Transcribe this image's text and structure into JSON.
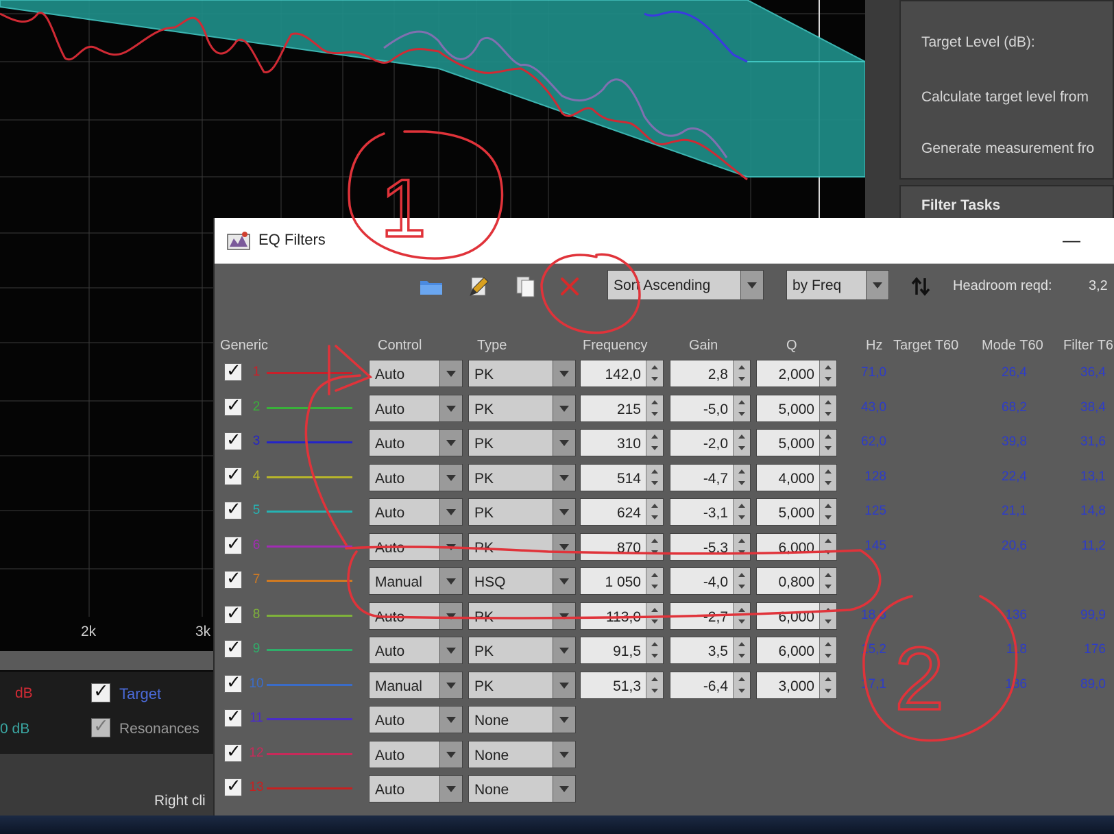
{
  "graph": {
    "tick_2k": "2k",
    "tick_3k": "3k",
    "legend": {
      "target_label": "Target",
      "resonances_label": "Resonances",
      "left_db_1": "dB",
      "left_db_2": "0 dB"
    },
    "hint_text": "Right cli"
  },
  "right_panel": {
    "target_level": "Target Level (dB):",
    "calc_target": "Calculate target level from",
    "generate": "Generate measurement fro",
    "filter_tasks": "Filter Tasks"
  },
  "eq_window": {
    "title": "EQ Filters",
    "minimize_glyph": "—",
    "toolbar": {
      "icons": [
        "folder-icon",
        "edit-pen-icon",
        "copy-icon",
        "delete-icon",
        "sort-arrows-icon"
      ],
      "sort_order": "Sort Ascending",
      "sort_by": "by Freq",
      "headroom_label": "Headroom reqd:",
      "headroom_value": "3,2"
    },
    "headers": {
      "generic": "Generic",
      "control": "Control",
      "type": "Type",
      "frequency": "Frequency",
      "gain": "Gain",
      "q": "Q",
      "hz": "Hz",
      "target_t60": "Target T60",
      "mode_t60": "Mode T60",
      "filter_t60": "Filter T6"
    },
    "filters": [
      {
        "num": "1",
        "color": "#c8202a",
        "control": "Auto",
        "type": "PK",
        "freq": "142,0",
        "gain": "2,8",
        "q": "2,000",
        "hz": "71,0",
        "mode_t60": "26,4",
        "filter_t60": "36,4"
      },
      {
        "num": "2",
        "color": "#39b13a",
        "control": "Auto",
        "type": "PK",
        "freq": "215",
        "gain": "-5,0",
        "q": "5,000",
        "hz": "43,0",
        "mode_t60": "68,2",
        "filter_t60": "38,4"
      },
      {
        "num": "3",
        "color": "#2424c8",
        "control": "Auto",
        "type": "PK",
        "freq": "310",
        "gain": "-2,0",
        "q": "5,000",
        "hz": "62,0",
        "mode_t60": "39,8",
        "filter_t60": "31,6"
      },
      {
        "num": "4",
        "color": "#b7b52a",
        "control": "Auto",
        "type": "PK",
        "freq": "514",
        "gain": "-4,7",
        "q": "4,000",
        "hz": "128",
        "mode_t60": "22,4",
        "filter_t60": "13,1"
      },
      {
        "num": "5",
        "color": "#25b4b4",
        "control": "Auto",
        "type": "PK",
        "freq": "624",
        "gain": "-3,1",
        "q": "5,000",
        "hz": "125",
        "mode_t60": "21,1",
        "filter_t60": "14,8"
      },
      {
        "num": "6",
        "color": "#a22cb4",
        "control": "Auto",
        "type": "PK",
        "freq": "870",
        "gain": "-5,3",
        "q": "6,000",
        "hz": "145",
        "mode_t60": "20,6",
        "filter_t60": "11,2"
      },
      {
        "num": "7",
        "color": "#d07a22",
        "control": "Manual",
        "type": "HSQ",
        "freq": "1 050",
        "gain": "-4,0",
        "q": "0,800",
        "hz": "",
        "mode_t60": "",
        "filter_t60": ""
      },
      {
        "num": "8",
        "color": "#7fb33a",
        "control": "Auto",
        "type": "PK",
        "freq": "113,0",
        "gain": "-2,7",
        "q": "6,000",
        "hz": "18,8",
        "mode_t60": "136",
        "filter_t60": "99,9"
      },
      {
        "num": "9",
        "color": "#2fae6a",
        "control": "Auto",
        "type": "PK",
        "freq": "91,5",
        "gain": "3,5",
        "q": "6,000",
        "hz": "15,2",
        "mode_t60": "118",
        "filter_t60": "176"
      },
      {
        "num": "10",
        "color": "#3a6cc8",
        "control": "Manual",
        "type": "PK",
        "freq": "51,3",
        "gain": "-6,4",
        "q": "3,000",
        "hz": "17,1",
        "mode_t60": "186",
        "filter_t60": "89,0"
      },
      {
        "num": "11",
        "color": "#4a2cc8",
        "control": "Auto",
        "type": "None",
        "freq": "",
        "gain": "",
        "q": "",
        "hz": "",
        "mode_t60": "",
        "filter_t60": ""
      },
      {
        "num": "12",
        "color": "#c82a5a",
        "control": "Auto",
        "type": "None",
        "freq": "",
        "gain": "",
        "q": "",
        "hz": "",
        "mode_t60": "",
        "filter_t60": ""
      },
      {
        "num": "13",
        "color": "#c82020",
        "control": "Auto",
        "type": "None",
        "freq": "",
        "gain": "",
        "q": "",
        "hz": "",
        "mode_t60": "",
        "filter_t60": ""
      }
    ]
  },
  "annotations": {
    "label_1": "1",
    "label_2": "2",
    "ink_color": "#e0333a"
  }
}
